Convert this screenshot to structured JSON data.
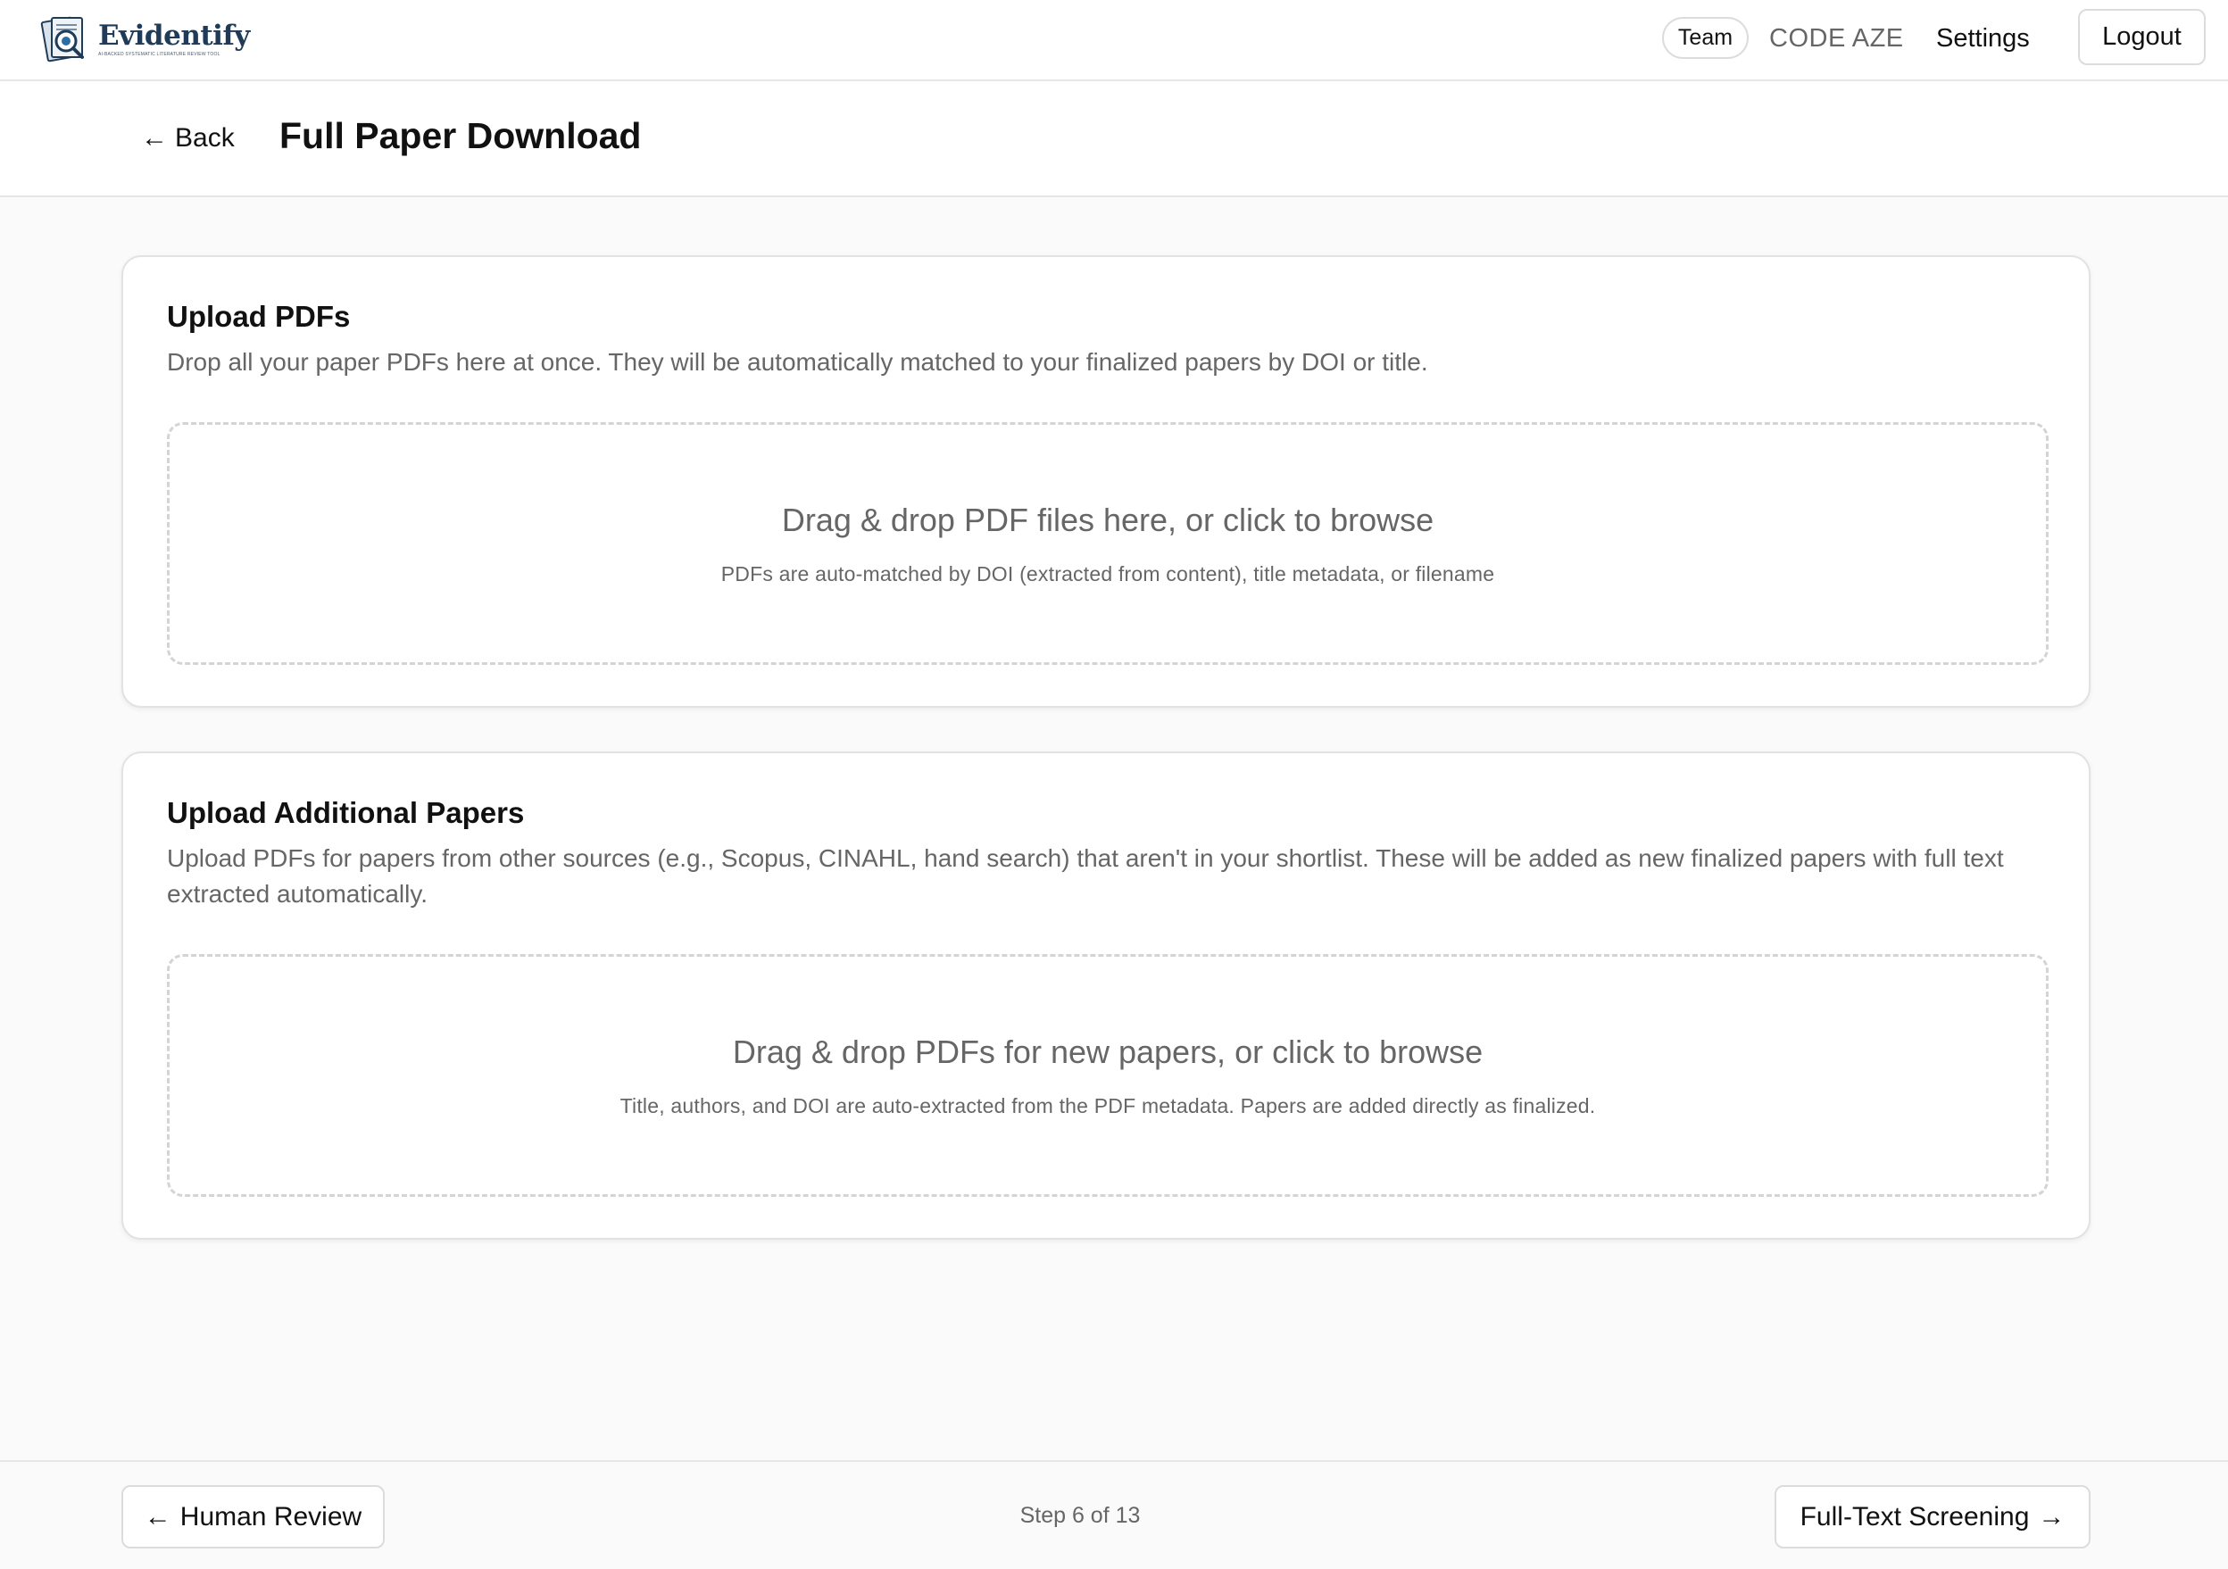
{
  "app": {
    "brand_name": "Evidentify",
    "brand_tagline": "AI-BACKED SYSTEMATIC LITERATURE REVIEW TOOL"
  },
  "topbar": {
    "team_label": "Team",
    "user_code": "CODE AZE",
    "settings_label": "Settings",
    "logout_label": "Logout"
  },
  "header": {
    "back_label": "Back",
    "title": "Full Paper Download"
  },
  "upload_pdfs": {
    "title": "Upload PDFs",
    "description": "Drop all your paper PDFs here at once. They will be automatically matched to your finalized papers by DOI or title.",
    "dropzone_main": "Drag & drop PDF files here, or click to browse",
    "dropzone_sub": "PDFs are auto-matched by DOI (extracted from content), title metadata, or filename"
  },
  "upload_additional": {
    "title": "Upload Additional Papers",
    "description": "Upload PDFs for papers from other sources (e.g., Scopus, CINAHL, hand search) that aren't in your shortlist. These will be added as new finalized papers with full text extracted automatically.",
    "dropzone_main": "Drag & drop PDFs for new papers, or click to browse",
    "dropzone_sub": "Title, authors, and DOI are auto-extracted from the PDF metadata. Papers are added directly as finalized."
  },
  "footer": {
    "prev_label": "Human Review",
    "step_text": "Step 6 of 13",
    "next_label": "Full-Text Screening"
  },
  "icons": {
    "back": "arrow-left-icon",
    "prev": "arrow-left-icon",
    "next": "arrow-right-icon",
    "logo": "magnifier-document-icon"
  },
  "colors": {
    "brand": "#1f3b57",
    "muted_text": "#666666",
    "border": "#dcdcdc",
    "background": "#fafafa"
  }
}
